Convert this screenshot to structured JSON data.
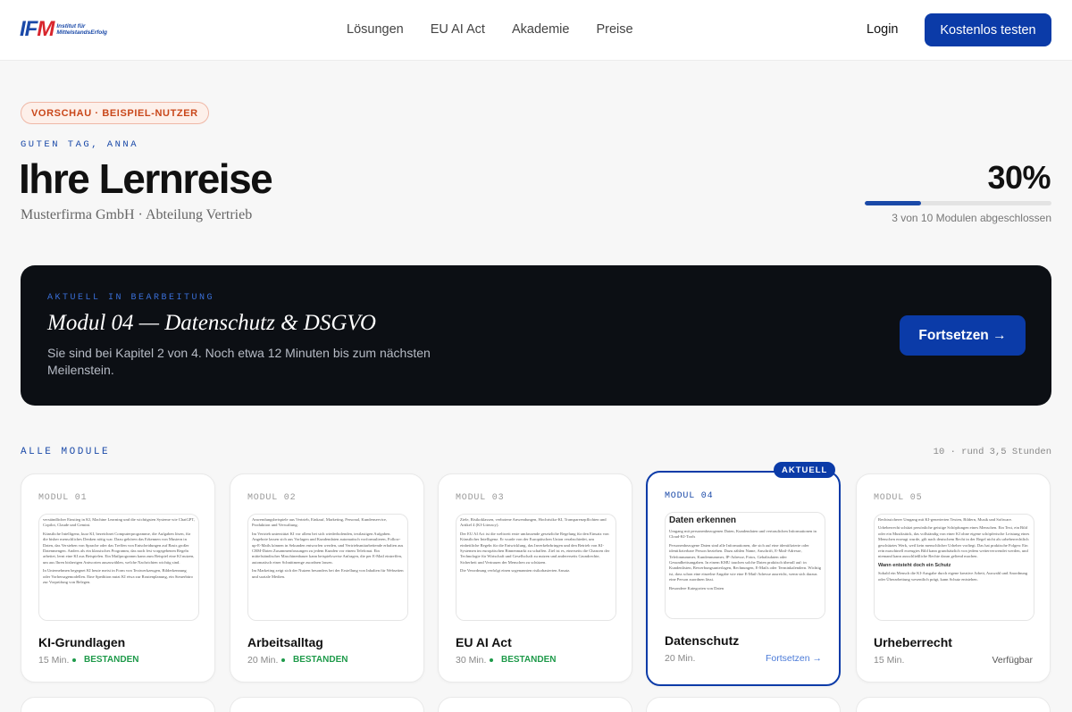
{
  "header": {
    "logo_mark_1": "IF",
    "logo_mark_2": "M",
    "logo_sub_1": "Institut für",
    "logo_sub_2": "MittelstandsErfolg",
    "nav": [
      "Lösungen",
      "EU AI Act",
      "Akademie",
      "Preise"
    ],
    "login": "Login",
    "cta": "Kostenlos testen"
  },
  "hero": {
    "badge": "VORSCHAU · BEISPIEL-NUTZER",
    "greeting": "GUTEN TAG, ANNA",
    "title": "Ihre Lernreise",
    "company": "Musterfirma GmbH · Abteilung Vertrieb",
    "percent": "30%",
    "progress_fraction": 0.3,
    "progress_text": "3 von 10 Modulen abgeschlossen"
  },
  "current": {
    "label": "AKTUELL IN BEARBEITUNG",
    "title": "Modul 04 — Datenschutz & DSGVO",
    "desc": "Sie sind bei Kapitel 2 von 4. Noch etwa 12 Minuten bis zum nächsten Meilenstein.",
    "button": "Fortsetzen →"
  },
  "modules": {
    "heading": "ALLE MODULE",
    "meta": "10 · rund 3,5 Stunden",
    "active_tag": "AKTUELL",
    "cards": [
      {
        "num": "MODUL 01",
        "title": "KI-Grundlagen",
        "duration": "15 Min.",
        "status": "BESTANDEN",
        "preview": [
          "verständlicher Einstieg in KI, Machine Learning und die wichtigsten Systeme wie ChatGPT, Copilot, Claude und Gemini.",
          "Künstliche Intelligenz, kurz KI, bezeichnet Computerprogramme, die Aufgaben lösen, für die bisher menschliches Denken nötig war. Dazu gehören das Erkennen von Mustern in Daten, das Verstehen von Sprache oder das Treffen von Entscheidungen auf Basis großer Datenmengen. Anders als ein klassisches Programm, das nach fest vorgegebenen Regeln arbeitet, lernt eine KI aus Beispielen. Ein Mailprogramm kann zum Beispiel eine KI nutzen, um aus Ihren bisherigen Antworten auszuwählen, welche Nachrichten wichtig sind.",
          "In Unternehmen begegnet KI heute meist in Form von Textwerkzeugen, Bilderkennung oder Vorhersagemodellen. Eine Spedition nutzt KI etwa zur Routenplanung, ein Steuerbüro zur Vorprüfung von Belegen."
        ]
      },
      {
        "num": "MODUL 02",
        "title": "Arbeitsalltag",
        "duration": "20 Min.",
        "status": "BESTANDEN",
        "preview": [
          "Anwendungsbeispiele aus Vertrieb, Einkauf, Marketing, Personal, Kundenservice, Produktion und Verwaltung.",
          "Im Vertrieb unterstützt KI vor allem bei sich wiederholenden, textlastigen Aufgaben. Angebote lassen sich aus Vorlagen und Kundendaten automatisch vorformulieren, Follow-up-E-Mails können in Sekunden entworfen werden, und Vertriebsmitarbeitende erhalten aus CRM-Daten Zusammenfassungen zu jedem Kunden vor einem Telefonat. Ein mittelständischer Maschinenbauer kann beispielsweise Anfragen, die per E-Mail eintreffen, automatisch einer Schnittmenge zuordnen lassen.",
          "Im Marketing zeigt sich der Nutzen besonders bei der Erstellung von Inhalten für Webseiten und soziale Medien."
        ]
      },
      {
        "num": "MODUL 03",
        "title": "EU AI Act",
        "duration": "30 Min.",
        "status": "BESTANDEN",
        "preview": [
          "Ziele, Risikoklassen, verbotene Anwendungen, Hochrisiko-KI, Transparenzpflichten und Artikel 4 (KI-Literacy).",
          "Der EU AI Act ist die weltweit erste umfassende gesetzliche Regelung für den Einsatz von Künstlicher Intelligenz. Er wurde von der Europäischen Union verabschiedet, um einheitliche Regeln für die Entwicklung, das Inverkehrbringen und den Betrieb von KI-Systemen im europäischen Binnenmarkt zu schaffen. Ziel ist es, einerseits die Chancen der Technologie für Wirtschaft und Gesellschaft zu nutzen und andererseits Grundrechte, Sicherheit und Vertrauen der Menschen zu schützen.",
          "Die Verordnung verfolgt einen sogenannten risikobasierten Ansatz."
        ]
      },
      {
        "num": "MODUL 04",
        "title": "Datenschutz",
        "duration": "20 Min.",
        "status": "Fortsetzen →",
        "preview_head": "Daten erkennen",
        "preview": [
          "Umgang mit personenbezogenen Daten, Kundendaten und vertraulichen Informationen in Cloud-KI-Tools",
          "Personenbezogene Daten sind alle Informationen, die sich auf eine identifizierte oder identifizierbare Person beziehen. Dazu zählen Name, Anschrift, E-Mail-Adresse, Telefonnummer, Kundennummer, IP-Adresse, Fotos, Gehaltsdaten oder Gesundheitsangaben. In einem KMU tauchen solche Daten praktisch überall auf: in Kundenlisten, Bewerbungsunterlagen, Rechnungen, E-Mails oder Terminkalendern. Wichtig ist, dass schon eine einzelne Angabe wie eine E-Mail-Adresse ausreicht, wenn sich daraus eine Person zuordnen lässt.",
          "Besondere Kategorien von Daten"
        ]
      },
      {
        "num": "MODUL 05",
        "title": "Urheberrecht",
        "duration": "15 Min.",
        "status": "Verfügbar",
        "preview": [
          "Rechtssicherer Umgang mit KI-generierten Texten, Bildern, Musik und Software.",
          "Urheberrecht schützt persönliche geistige Schöpfungen eines Menschen. Ein Text, ein Bild oder ein Musikstück, das vollständig von einer KI ohne eigene schöpferische Leistung eines Menschen erzeugt wurde, gilt nach deutschem Recht in der Regel nicht als urheberrechtlich geschütztes Werk, weil kein menschlicher Urheber vorliegt. Das hat praktische Folgen: Ein rein maschinell erzeugtes Bild kann grundsätzlich von jedem weiterverwendet werden, und niemand kann ausschließliche Rechte daran geltend machen.",
          "Wann entsteht doch ein Schutz",
          "Sobald ein Mensch die KI-Ausgabe durch eigene kreative Arbeit, Auswahl und Anordnung oder Überarbeitung wesentlich prägt, kann Schutz entstehen."
        ]
      }
    ]
  }
}
